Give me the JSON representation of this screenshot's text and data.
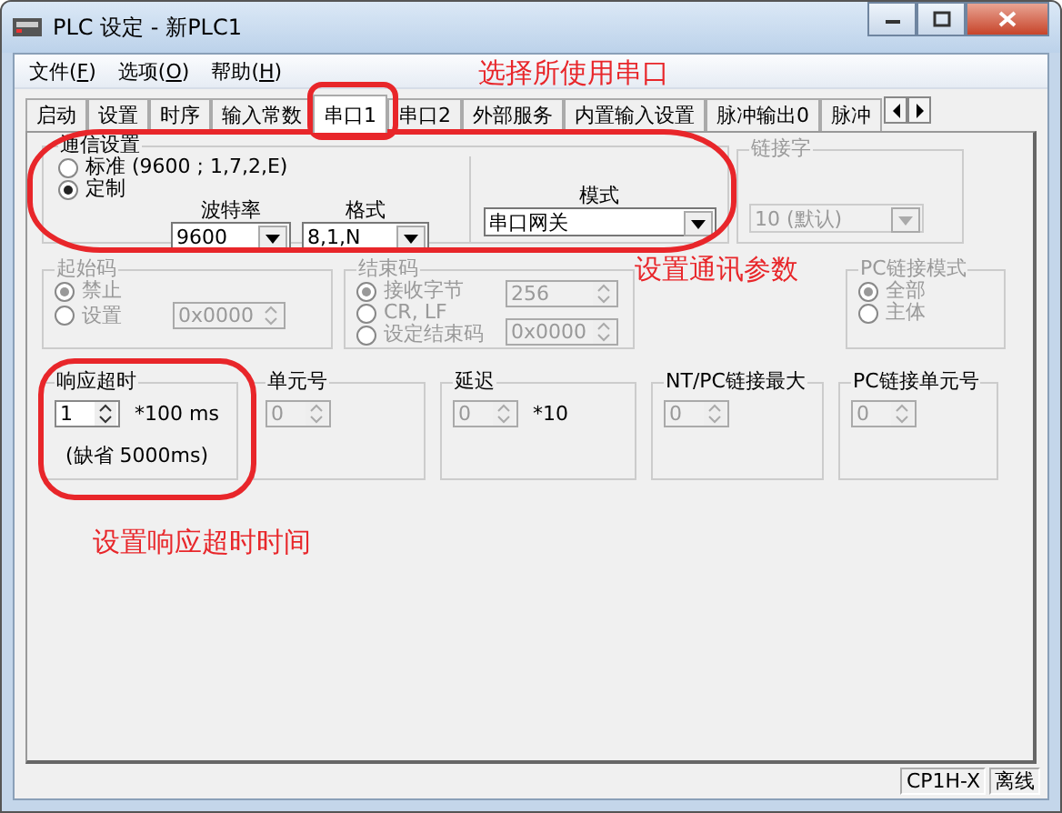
{
  "window": {
    "title": "PLC 设定 - 新PLC1"
  },
  "menu": [
    {
      "prefix": "文件(",
      "key": "F",
      "suffix": ")"
    },
    {
      "prefix": "选项(",
      "key": "O",
      "suffix": ")"
    },
    {
      "prefix": "帮助(",
      "key": "H",
      "suffix": ")"
    }
  ],
  "tabs": [
    {
      "label": "启动",
      "selected": false
    },
    {
      "label": "设置",
      "selected": false
    },
    {
      "label": "时序",
      "selected": false
    },
    {
      "label": "输入常数",
      "selected": false
    },
    {
      "label": "串口1",
      "selected": true
    },
    {
      "label": "串口2",
      "selected": false
    },
    {
      "label": "外部服务",
      "selected": false
    },
    {
      "label": "内置输入设置",
      "selected": false
    },
    {
      "label": "脉冲输出0",
      "selected": false
    },
    {
      "label": "脉冲",
      "selected": false
    }
  ],
  "comm_settings": {
    "title": "通信设置",
    "radios": [
      {
        "label": "标准 (9600 ; 1,7,2,E)",
        "selected": false
      },
      {
        "label": "定制",
        "selected": true
      }
    ],
    "baud": {
      "label": "波特率",
      "value": "9600"
    },
    "format": {
      "label": "格式",
      "value": "8,1,N"
    },
    "mode": {
      "label": "模式",
      "value": "串口网关"
    }
  },
  "link_word": {
    "title": "链接字",
    "value": "10 (默认)",
    "disabled": true
  },
  "start_code": {
    "title": "起始码",
    "disabled": true,
    "radios": [
      {
        "label": "禁止",
        "selected": true
      },
      {
        "label": "设置",
        "selected": false
      }
    ],
    "value": "0x0000"
  },
  "end_code": {
    "title": "结束码",
    "disabled": true,
    "radios": [
      {
        "label": "接收字节",
        "selected": true
      },
      {
        "label": "CR, LF",
        "selected": false
      },
      {
        "label": "设定结束码",
        "selected": false
      }
    ],
    "bytes": "256",
    "code": "0x0000"
  },
  "pc_link_mode": {
    "title": "PC链接模式",
    "disabled": true,
    "radios": [
      {
        "label": "全部",
        "selected": true
      },
      {
        "label": "主体",
        "selected": false
      }
    ]
  },
  "spin_groups": [
    {
      "title": "响应超时",
      "value": "1",
      "unit": "*100 ms",
      "note": "(缺省 5000ms)",
      "disabled": false
    },
    {
      "title": "单元号",
      "value": "0",
      "disabled": true
    },
    {
      "title": "延迟",
      "value": "0",
      "unit": "*10",
      "disabled": true
    },
    {
      "title": "NT/PC链接最大",
      "value": "0",
      "disabled": true
    },
    {
      "title": "PC链接单元号",
      "value": "0",
      "disabled": true
    }
  ],
  "status_bar": [
    "CP1H-X",
    "离线"
  ],
  "annotations": [
    {
      "text": "选择所使用串口"
    },
    {
      "text": "设置通讯参数"
    },
    {
      "text": "设置响应超时时间"
    }
  ]
}
